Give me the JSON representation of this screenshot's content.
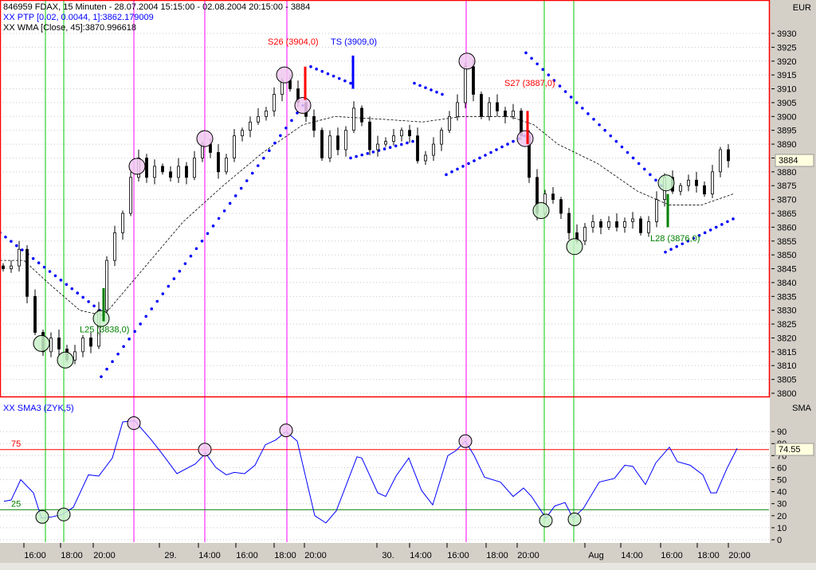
{
  "header": {
    "title": "846959 FDAX, 15 Minuten - 28.07.2004 15:15:00 - 02.08.2004 20:15:00 - 3884",
    "ptp": "XX PTP [0.02, 0.0044, 1]:3862.179009",
    "wma": "XX WMA [Close, 45]:3870.996618"
  },
  "colors": {
    "frame": "#ff0000",
    "axis_bg": "#d4d0c8",
    "ptp": "#0000ff",
    "green": "#00cc00",
    "magenta": "#ff00ff",
    "pink": "#f0c8f0",
    "lightgreen": "#c8f0c8",
    "long": "#008000",
    "short": "#ff0000"
  },
  "chart_data": [
    {
      "type": "candlestick",
      "title": "846959 FDAX, 15 Minuten",
      "currency_label": "EUR",
      "last_price_label": "3884",
      "ylim": [
        3798,
        3942
      ],
      "yticks": [
        3800,
        3805,
        3810,
        3815,
        3820,
        3825,
        3830,
        3835,
        3840,
        3845,
        3850,
        3855,
        3860,
        3865,
        3870,
        3875,
        3880,
        3885,
        3890,
        3895,
        3900,
        3905,
        3910,
        3915,
        3920,
        3925,
        3930
      ],
      "x_unit": "bar index (15 min)",
      "closes": [
        3845,
        3846,
        3852,
        3835,
        3822,
        3815,
        3820,
        3816,
        3812,
        3815,
        3820,
        3817,
        3830,
        3848,
        3858,
        3865,
        3878,
        3885,
        3878,
        3882,
        3880,
        3878,
        3882,
        3878,
        3885,
        3890,
        3887,
        3880,
        3885,
        3893,
        3895,
        3898,
        3900,
        3902,
        3908,
        3913,
        3910,
        3905,
        3900,
        3895,
        3885,
        3893,
        3888,
        3895,
        3903,
        3898,
        3888,
        3890,
        3891,
        3893,
        3895,
        3893,
        3884,
        3886,
        3890,
        3895,
        3900,
        3905,
        3918,
        3908,
        3900,
        3905,
        3902,
        3900,
        3902,
        3893,
        3878,
        3865,
        3872,
        3870,
        3865,
        3858,
        3855,
        3860,
        3862,
        3860,
        3862,
        3860,
        3862,
        3863,
        3858,
        3862,
        3870,
        3878,
        3873,
        3875,
        3877,
        3875,
        3872,
        3880,
        3888,
        3884
      ],
      "wma": [
        [
          -0.4,
          3848
        ],
        [
          2.6,
          3848
        ],
        [
          5.6,
          3840
        ],
        [
          9.6,
          3830
        ],
        [
          12.6,
          3828
        ],
        [
          17.6,
          3845
        ],
        [
          22.6,
          3862
        ],
        [
          27.6,
          3875
        ],
        [
          32.6,
          3887
        ],
        [
          37.6,
          3897
        ],
        [
          41.6,
          3900
        ],
        [
          47.6,
          3899
        ],
        [
          52.6,
          3898
        ],
        [
          57.6,
          3900
        ],
        [
          63.6,
          3900
        ],
        [
          66.6,
          3897
        ],
        [
          69.6,
          3890
        ],
        [
          74.6,
          3883
        ],
        [
          79.6,
          3873
        ],
        [
          83.6,
          3868
        ],
        [
          87.6,
          3868
        ],
        [
          91.6,
          3872
        ]
      ],
      "ptp_segments": [
        [
          -0.4,
          3858,
          12.1,
          3830
        ],
        [
          12.3,
          3806,
          37.6,
          3904
        ],
        [
          38.6,
          3918,
          43.6,
          3912
        ],
        [
          43.6,
          3885,
          51.4,
          3891
        ],
        [
          51.6,
          3912,
          55.1,
          3908
        ],
        [
          55.6,
          3879,
          65.4,
          3893
        ],
        [
          65.6,
          3923,
          82.6,
          3875
        ],
        [
          83.1,
          3851,
          91.6,
          3863
        ]
      ],
      "vlines": [
        {
          "x": 5.3,
          "color": "green"
        },
        {
          "x": 7.6,
          "color": "green"
        },
        {
          "x": 16.4,
          "color": "magenta"
        },
        {
          "x": 25.3,
          "color": "magenta"
        },
        {
          "x": 35.6,
          "color": "magenta"
        },
        {
          "x": 58.1,
          "color": "magenta"
        },
        {
          "x": 67.9,
          "color": "green"
        },
        {
          "x": 71.6,
          "color": "green"
        }
      ],
      "circles": [
        {
          "x": 4.8,
          "y": 3818,
          "kind": "low"
        },
        {
          "x": 7.8,
          "y": 3812,
          "kind": "low"
        },
        {
          "x": 12.3,
          "y": 3827,
          "kind": "low"
        },
        {
          "x": 16.8,
          "y": 3882,
          "kind": "high"
        },
        {
          "x": 25.3,
          "y": 3892,
          "kind": "high"
        },
        {
          "x": 35.3,
          "y": 3915,
          "kind": "high"
        },
        {
          "x": 37.6,
          "y": 3904,
          "kind": "high"
        },
        {
          "x": 58.2,
          "y": 3920,
          "kind": "high"
        },
        {
          "x": 65.5,
          "y": 3892,
          "kind": "high"
        },
        {
          "x": 67.5,
          "y": 3866,
          "kind": "low"
        },
        {
          "x": 71.7,
          "y": 3853,
          "kind": "low"
        },
        {
          "x": 83.2,
          "y": 3876,
          "kind": "low"
        }
      ],
      "signals": [
        {
          "label": "L25 (3838,0)",
          "x": 12.6,
          "price": 3832,
          "kind": "long",
          "label_x": 9.6,
          "label_y": 3822
        },
        {
          "label": "S26 (3904,0)",
          "x": 37.9,
          "price": 3912,
          "kind": "short",
          "label_x": 33.2,
          "label_y": 3926
        },
        {
          "label": "TS (3909,0)",
          "x": 43.9,
          "price": 3916,
          "kind": "stop",
          "label_x": 41.1,
          "label_y": 3926
        },
        {
          "label": "S27 (3887,0)",
          "x": 65.8,
          "price": 3896,
          "kind": "short",
          "label_x": 62.9,
          "label_y": 3911
        },
        {
          "label": "L28 (3876,0)",
          "x": 83.4,
          "price": 3866,
          "kind": "long",
          "label_x": 81.2,
          "label_y": 3855
        }
      ]
    },
    {
      "type": "line",
      "title": "XX  SMA3 (ZYK,5)",
      "axis_label": "SMA",
      "last_value_label": "74.55",
      "ylim": [
        0,
        100
      ],
      "yticks": [
        0,
        10,
        20,
        30,
        40,
        50,
        60,
        70,
        80,
        90
      ],
      "levels": [
        {
          "value": 75,
          "label": "75",
          "color": "#ff0000"
        },
        {
          "value": 25,
          "label": "25",
          "color": "#008000"
        }
      ],
      "points": [
        [
          0.1,
          32
        ],
        [
          1.0,
          33
        ],
        [
          2.2,
          50
        ],
        [
          3.8,
          39
        ],
        [
          4.8,
          18
        ],
        [
          6.1,
          19
        ],
        [
          7.4,
          21
        ],
        [
          8.8,
          27
        ],
        [
          10.7,
          54
        ],
        [
          12.0,
          53
        ],
        [
          13.7,
          68
        ],
        [
          15.0,
          98
        ],
        [
          16.5,
          99
        ],
        [
          18.6,
          83
        ],
        [
          19.9,
          72
        ],
        [
          21.8,
          55
        ],
        [
          24.1,
          63
        ],
        [
          25.4,
          72
        ],
        [
          26.7,
          60
        ],
        [
          28.0,
          54
        ],
        [
          29.0,
          56
        ],
        [
          30.3,
          55
        ],
        [
          31.6,
          62
        ],
        [
          32.9,
          79
        ],
        [
          34.2,
          83
        ],
        [
          35.5,
          90
        ],
        [
          36.9,
          82
        ],
        [
          39.1,
          20
        ],
        [
          40.5,
          14
        ],
        [
          41.8,
          24
        ],
        [
          44.4,
          69
        ],
        [
          45.0,
          68
        ],
        [
          47.0,
          39
        ],
        [
          48.0,
          36
        ],
        [
          49.3,
          53
        ],
        [
          50.9,
          68
        ],
        [
          52.5,
          41
        ],
        [
          53.9,
          29
        ],
        [
          55.8,
          70
        ],
        [
          56.8,
          74
        ],
        [
          58.0,
          82
        ],
        [
          59.1,
          70
        ],
        [
          60.4,
          52
        ],
        [
          62.4,
          48
        ],
        [
          64.0,
          36
        ],
        [
          65.3,
          43
        ],
        [
          66.3,
          36
        ],
        [
          68.1,
          18
        ],
        [
          69.2,
          28
        ],
        [
          70.5,
          31
        ],
        [
          71.5,
          18
        ],
        [
          72.8,
          26
        ],
        [
          74.8,
          48
        ],
        [
          76.7,
          51
        ],
        [
          78.0,
          62
        ],
        [
          79.0,
          61
        ],
        [
          80.6,
          46
        ],
        [
          81.9,
          64
        ],
        [
          83.6,
          77
        ],
        [
          84.6,
          65
        ],
        [
          86.2,
          62
        ],
        [
          87.8,
          54
        ],
        [
          88.8,
          39
        ],
        [
          89.5,
          39
        ],
        [
          90.8,
          59
        ],
        [
          92.1,
          76
        ]
      ],
      "circles": [
        {
          "x": 4.9,
          "y": 19,
          "kind": "low"
        },
        {
          "x": 7.6,
          "y": 21,
          "kind": "low"
        },
        {
          "x": 16.4,
          "y": 97,
          "kind": "high"
        },
        {
          "x": 25.3,
          "y": 75,
          "kind": "high"
        },
        {
          "x": 35.5,
          "y": 91,
          "kind": "high"
        },
        {
          "x": 58.0,
          "y": 82,
          "kind": "high"
        },
        {
          "x": 68.1,
          "y": 16,
          "kind": "low"
        },
        {
          "x": 71.7,
          "y": 17,
          "kind": "low"
        }
      ]
    }
  ],
  "time_axis": [
    {
      "x": 4.0,
      "label": "16:00"
    },
    {
      "x": 8.6,
      "label": "18:00"
    },
    {
      "x": 12.7,
      "label": "20:00"
    },
    {
      "x": 21.0,
      "label": "29."
    },
    {
      "x": 25.9,
      "label": "14:00"
    },
    {
      "x": 30.6,
      "label": "16:00"
    },
    {
      "x": 35.4,
      "label": "18:00"
    },
    {
      "x": 39.2,
      "label": "20:00"
    },
    {
      "x": 48.3,
      "label": "30."
    },
    {
      "x": 52.4,
      "label": "14:00"
    },
    {
      "x": 57.1,
      "label": "16:00"
    },
    {
      "x": 62.0,
      "label": "18:00"
    },
    {
      "x": 65.9,
      "label": "20:00"
    },
    {
      "x": 74.4,
      "label": "Aug"
    },
    {
      "x": 78.9,
      "label": "14:00"
    },
    {
      "x": 83.9,
      "label": "16:00"
    },
    {
      "x": 88.5,
      "label": "18:00"
    },
    {
      "x": 92.4,
      "label": "20:00"
    }
  ]
}
